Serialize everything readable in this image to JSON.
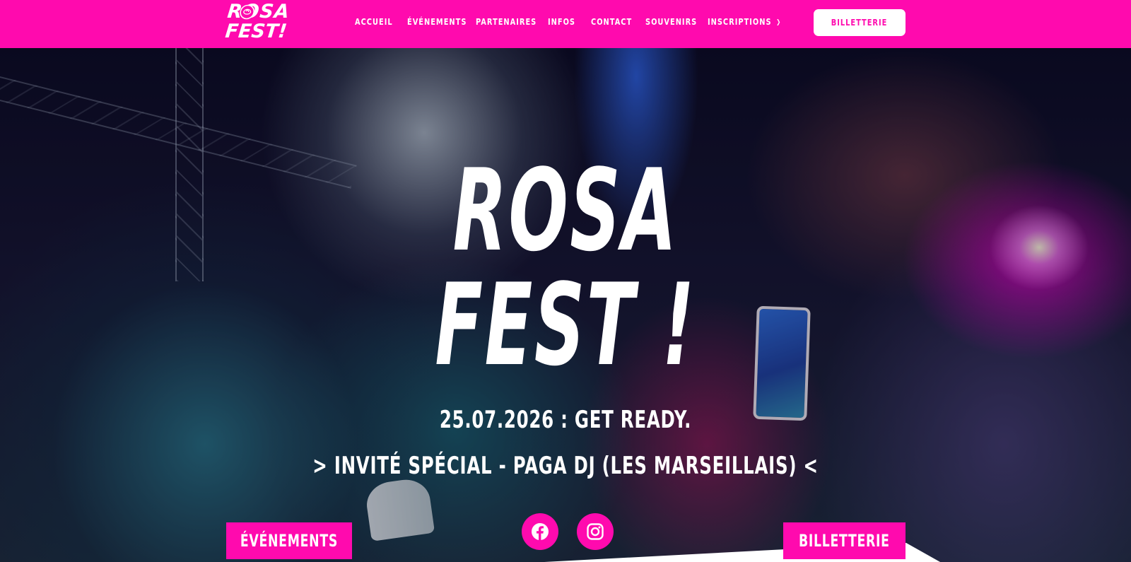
{
  "header": {
    "logo": {
      "line1": "ROSA",
      "line2": "FEST!"
    },
    "nav": [
      {
        "label": "ACCUEIL"
      },
      {
        "label": "ÉVÉNEMENTS"
      },
      {
        "label": "PARTENAIRES"
      },
      {
        "label": "INFOS"
      },
      {
        "label": "CONTACT"
      },
      {
        "label": "SOUVENIRS"
      },
      {
        "label": "INSCRIPTIONS",
        "has_dropdown": true
      }
    ],
    "ticket_button": "BILLETTERIE"
  },
  "hero": {
    "title_line1": "ROSA",
    "title_line2": "FEST !",
    "date_line": "25.07.2026 : GET READY.",
    "guest_line": "> INVITÉ SPÉCIAL - PAGA DJ (LES MARSEILLAIS) <",
    "events_button": "ÉVÉNEMENTS",
    "tickets_button": "BILLETTERIE",
    "social": [
      {
        "icon": "facebook-icon"
      },
      {
        "icon": "instagram-icon"
      }
    ]
  },
  "colors": {
    "brand_pink": "#ff0aae",
    "text_white": "#ffffff"
  }
}
